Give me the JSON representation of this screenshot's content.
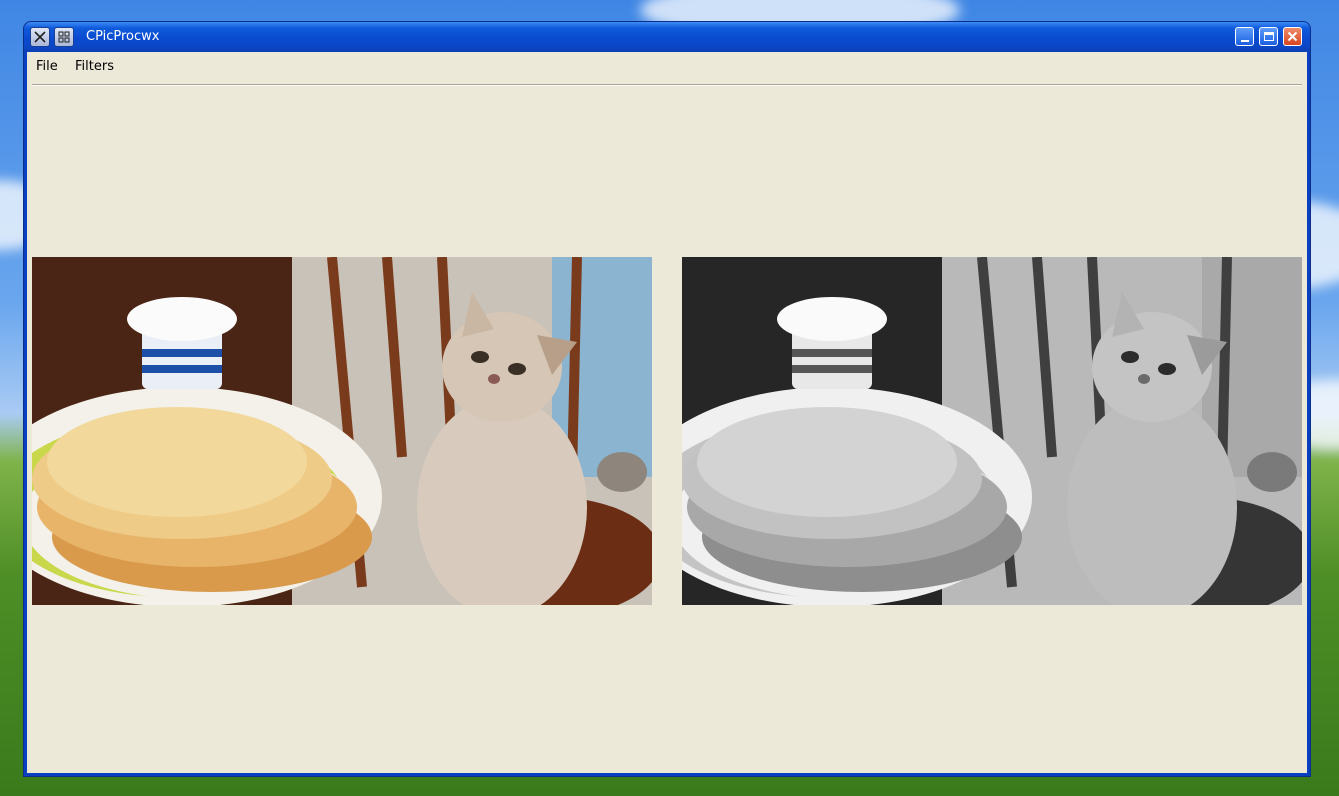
{
  "window": {
    "title": "CPicProcwx",
    "icon_left": "x-icon",
    "icon_right": "grid-icon"
  },
  "menu": {
    "items": [
      {
        "label": "File"
      },
      {
        "label": "Filters"
      }
    ]
  },
  "images": {
    "original": {
      "description_icon": "photo-color"
    },
    "processed": {
      "description_icon": "photo-grayscale"
    }
  },
  "colors": {
    "title_bar": "#0a4bd0",
    "client_bg": "#ece9d8",
    "close_button": "#d9441f"
  }
}
